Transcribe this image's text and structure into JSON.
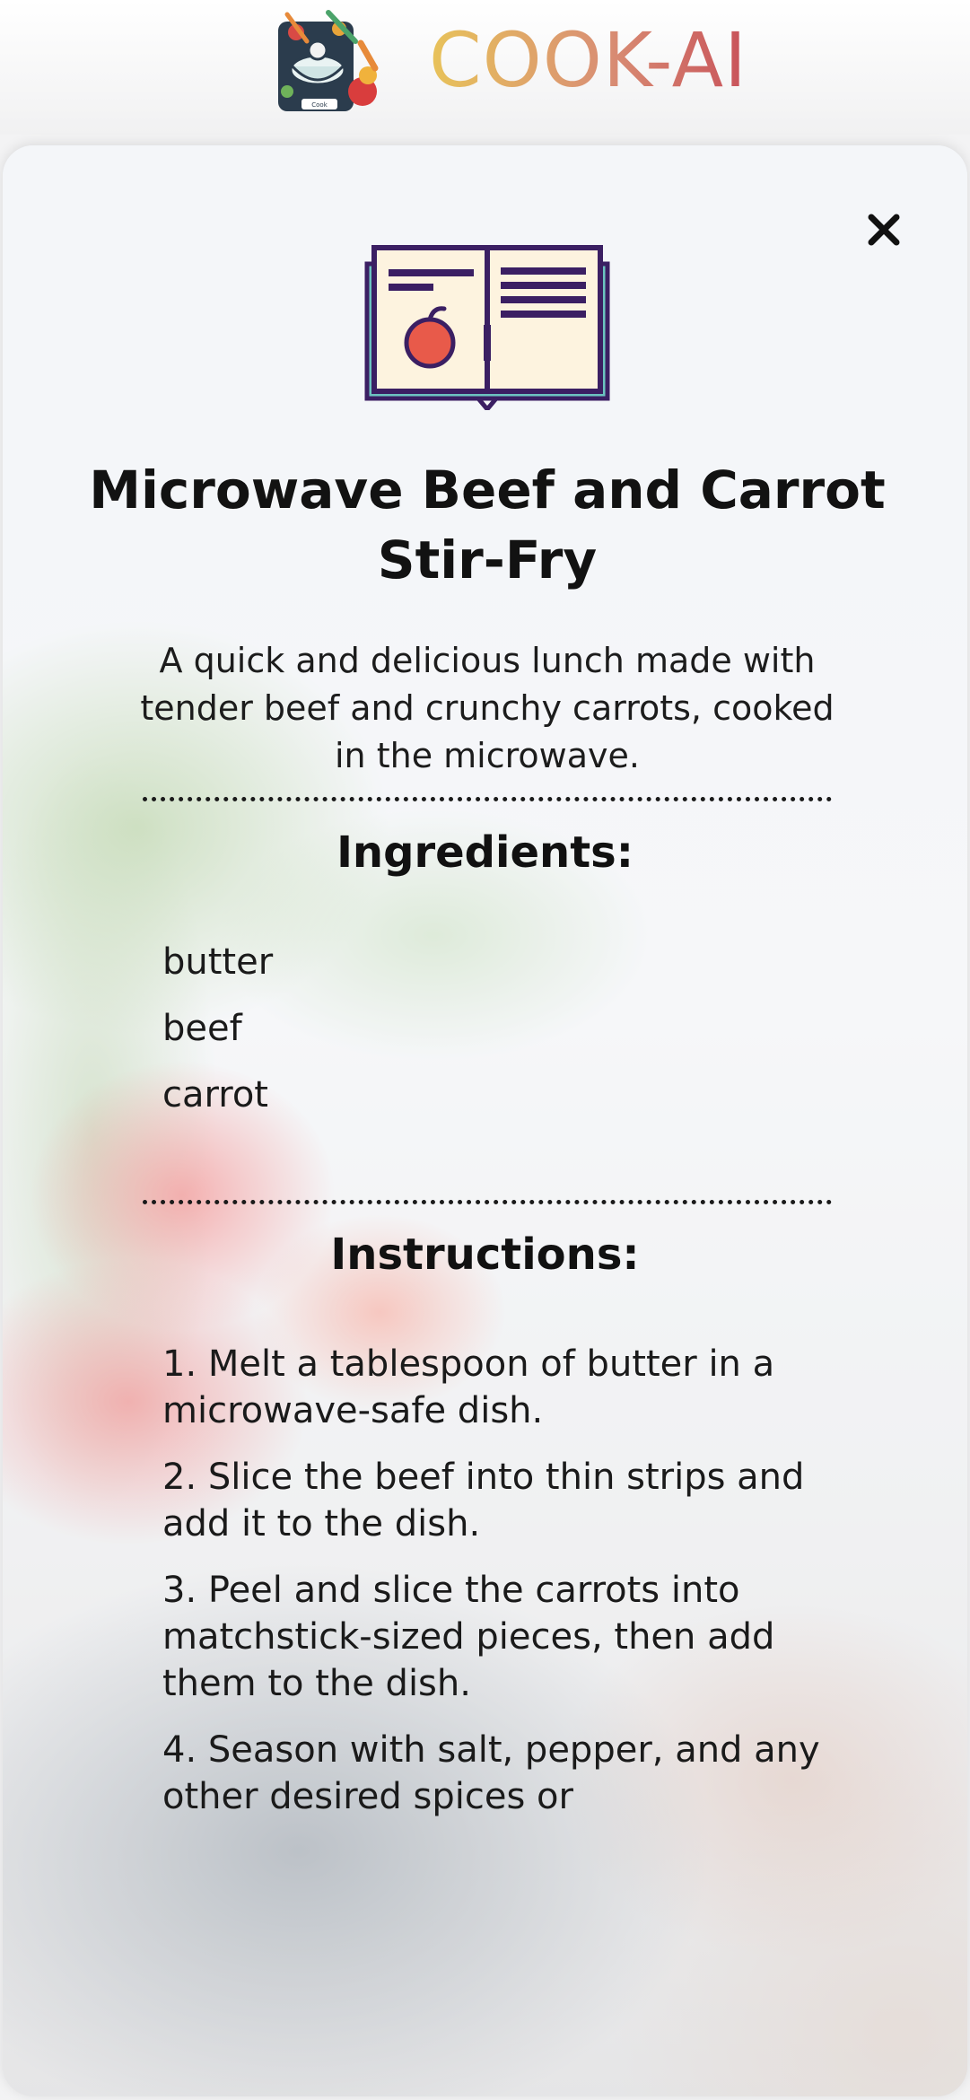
{
  "header": {
    "brand": "COOK-AI",
    "logo_icon": "cook-logo-icon"
  },
  "recipe": {
    "close_icon": "close-icon",
    "book_icon": "recipe-book-icon",
    "title": "Microwave Beef and Carrot Stir-Fry",
    "description": "A quick and delicious lunch made with tender beef and crunchy carrots, cooked in the microwave.",
    "ingredients_heading": "Ingredients:",
    "ingredients": [
      "butter",
      "beef",
      "carrot"
    ],
    "instructions_heading": "Instructions:",
    "instructions": [
      "1. Melt a tablespoon of butter in a microwave-safe dish.",
      "2. Slice the beef into thin strips and add it to the dish.",
      "3. Peel and slice the carrots into matchstick-sized pieces, then add them to the dish.",
      "4. Season with salt, pepper, and any other desired spices or"
    ]
  },
  "colors": {
    "brand_gradient_start": "#e8c35a",
    "brand_gradient_end": "#c8525a",
    "book_outline": "#3b1f63",
    "book_page": "#fdf3df",
    "book_base": "#6cc3c0",
    "tomato": "#e85a4a"
  }
}
